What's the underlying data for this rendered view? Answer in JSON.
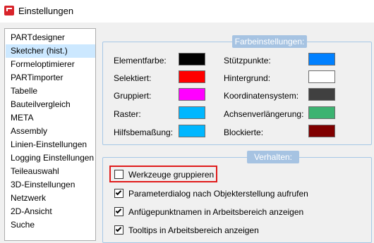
{
  "window": {
    "title": "Einstellungen"
  },
  "sidebar": {
    "items": [
      {
        "label": "PARTdesigner",
        "selected": false
      },
      {
        "label": "Sketcher (hist.)",
        "selected": true
      },
      {
        "label": "Formeloptimierer",
        "selected": false
      },
      {
        "label": "PARTimporter",
        "selected": false
      },
      {
        "label": "Tabelle",
        "selected": false
      },
      {
        "label": "Bauteilvergleich",
        "selected": false
      },
      {
        "label": "META",
        "selected": false
      },
      {
        "label": "Assembly",
        "selected": false
      },
      {
        "label": "Linien-Einstellungen",
        "selected": false
      },
      {
        "label": "Logging Einstellungen",
        "selected": false
      },
      {
        "label": "Teileauswahl",
        "selected": false
      },
      {
        "label": "3D-Einstellungen",
        "selected": false
      },
      {
        "label": "Netzwerk",
        "selected": false
      },
      {
        "label": "2D-Ansicht",
        "selected": false
      },
      {
        "label": "Suche",
        "selected": false
      }
    ]
  },
  "farb": {
    "title": "Farbeinstellungen:",
    "left": [
      {
        "label": "Elementfarbe:",
        "color": "#000000"
      },
      {
        "label": "Selektiert:",
        "color": "#ff0000"
      },
      {
        "label": "Gruppiert:",
        "color": "#ff00ff"
      },
      {
        "label": "Raster:",
        "color": "#00b7ff"
      },
      {
        "label": "Hilfsbemaßung:",
        "color": "#00b7ff"
      }
    ],
    "right": [
      {
        "label": "Stützpunkte:",
        "color": "#0080ff"
      },
      {
        "label": "Hintergrund:",
        "color": "#ffffff"
      },
      {
        "label": "Koordinatensystem:",
        "color": "#404040"
      },
      {
        "label": "Achsenverlängerung:",
        "color": "#3cb371"
      },
      {
        "label": "Blockierte:",
        "color": "#800000"
      }
    ]
  },
  "verhalten": {
    "title": "Verhalten:",
    "options": [
      {
        "label": "Werkzeuge gruppieren",
        "checked": false
      },
      {
        "label": "Parameterdialog nach Objekterstellung aufrufen",
        "checked": true
      },
      {
        "label": "Anfügepunktnamen in Arbeitsbereich anzeigen",
        "checked": true
      },
      {
        "label": "Tooltips in Arbeitsbereich anzeigen",
        "checked": true
      }
    ]
  }
}
